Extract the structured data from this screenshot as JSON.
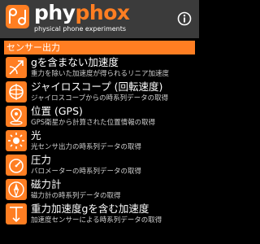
{
  "header": {
    "brand_phy": "phy",
    "brand_phox": "phox",
    "subtitle": "physical phone experiments",
    "logo_icon": "phyphox-logo-icon",
    "info_icon": "info-icon"
  },
  "colors": {
    "accent": "#ff7e22",
    "header_bg": "#3b3b3b",
    "background": "#000000",
    "text": "#ffffff",
    "subtext": "#cfcfcf"
  },
  "section": {
    "title": "センサー出力"
  },
  "experiments": [
    {
      "title": "gを含まない加速度",
      "description": "重力を除いた加速度が得られるリニア加速度",
      "icon": "linear-acceleration-icon"
    },
    {
      "title": "ジャイロスコープ (回転速度)",
      "description": "ジャイロスコープからの時系列データの取得",
      "icon": "gyroscope-icon"
    },
    {
      "title": "位置 (GPS)",
      "description": "GPS衛星から計算された位置情報の取得",
      "icon": "location-icon"
    },
    {
      "title": "光",
      "description": "光センサ出力の時系列データの取得",
      "icon": "light-icon"
    },
    {
      "title": "圧力",
      "description": "バロメーターの時系列データの取得",
      "icon": "pressure-icon"
    },
    {
      "title": "磁力計",
      "description": "磁力計の時系列データの取得",
      "icon": "magnetometer-icon"
    },
    {
      "title": "重力加速度gを含む加速度",
      "description": "加速度センサーによる時系列データの取得",
      "icon": "acceleration-with-g-icon"
    }
  ]
}
